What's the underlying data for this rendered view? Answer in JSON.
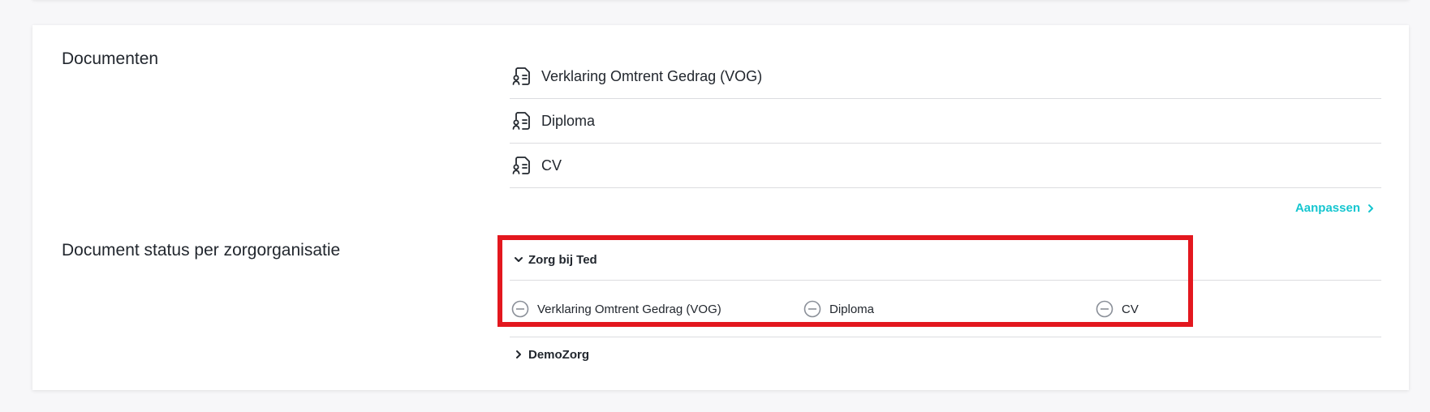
{
  "documents_section": {
    "title": "Documenten",
    "items": [
      {
        "label": "Verklaring Omtrent Gedrag (VOG)",
        "icon": "document-icon"
      },
      {
        "label": "Diploma",
        "icon": "document-icon"
      },
      {
        "label": "CV",
        "icon": "document-icon"
      }
    ],
    "edit_label": "Aanpassen"
  },
  "status_section": {
    "title": "Document status per zorgorganisatie",
    "organizations": [
      {
        "name": "Zorg bij Ted",
        "expanded": true,
        "statuses": [
          {
            "label": "Verklaring Omtrent Gedrag (VOG)",
            "icon": "minus-circle-icon"
          },
          {
            "label": "Diploma",
            "icon": "minus-circle-icon"
          },
          {
            "label": "CV",
            "icon": "minus-circle-icon"
          }
        ]
      },
      {
        "name": "DemoZorg",
        "expanded": false
      }
    ]
  },
  "colors": {
    "accent": "#16c6d0",
    "highlight": "#e3171e",
    "text": "#22272e",
    "divider": "#dcdde0"
  }
}
